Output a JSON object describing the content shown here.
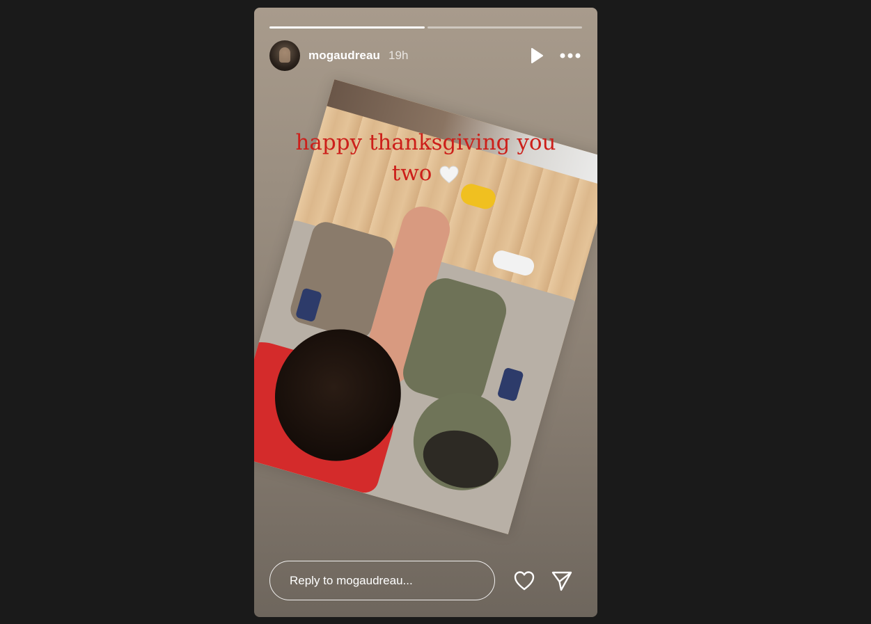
{
  "story": {
    "progress": {
      "segments": [
        {
          "filled": 1.0
        },
        {
          "filled": 0.0
        }
      ]
    },
    "header": {
      "username": "mogaudreau",
      "time_ago": "19h",
      "play_icon": "play-icon",
      "more_icon": "more-horizontal-icon"
    },
    "caption": {
      "line1": "happy thanksgiving you",
      "line2": "two",
      "emoji": "white-heart-icon"
    },
    "reply": {
      "placeholder": "Reply to mogaudreau...",
      "like_icon": "heart-outline-icon",
      "share_icon": "send-icon"
    }
  },
  "colors": {
    "background": "#1a1a1a",
    "caption_red": "#cc1f1a",
    "white": "#ffffff"
  }
}
